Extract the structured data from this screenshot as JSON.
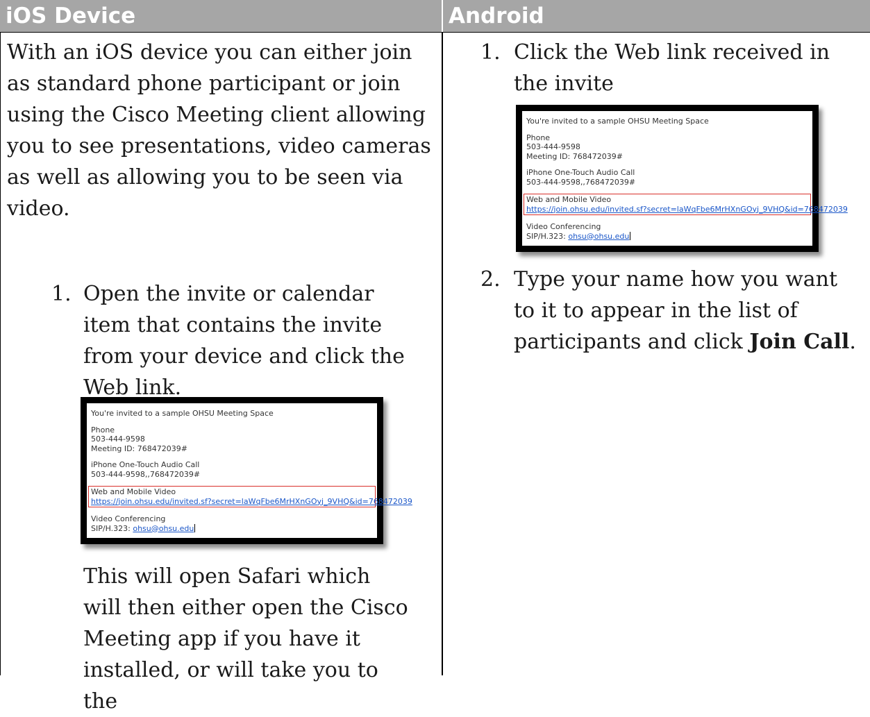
{
  "headers": {
    "ios": "iOS Device",
    "android": "Android"
  },
  "ios": {
    "intro": "With an iOS device you can either join as standard phone participant or join using the Cisco Meeting client allowing you to see presentations, video cameras as well as allowing you to be seen via video.",
    "step1_num": "1.",
    "step1_text": "Open the invite or calendar item that contains the invite from your device and click the Web link.",
    "after_text": "This will open Safari which will then either open the Cisco Meeting app if you have it installed, or will take you to the"
  },
  "android": {
    "step1_num": "1.",
    "step1_text": "Click the Web link received in the invite",
    "step2_num": "2.",
    "step2_text_before": "Type your name how you want to it to appear in the list of participants and click ",
    "step2_bold": "Join Call",
    "step2_text_after": "."
  },
  "invite": {
    "title": "You're invited to a sample OHSU Meeting Space",
    "phone_label": "Phone",
    "phone_number": "503-444-9598",
    "meeting_id": "Meeting ID: 768472039#",
    "iphone_label": "iPhone One-Touch Audio Call",
    "iphone_number": "503-444-9598,,768472039#",
    "web_label": "Web and Mobile Video",
    "web_link": "https://join.ohsu.edu/invited.sf?secret=laWqFbe6MrHXnGOyj_9VHQ&id=768472039",
    "video_label": "Video Conferencing",
    "sip_prefix": "SIP/H.323: ",
    "sip_address": "ohsu@ohsu.edu"
  },
  "colors": {
    "header_bg": "#a6a6a6",
    "highlight_border": "#d9302b",
    "link": "#1a56c8"
  }
}
